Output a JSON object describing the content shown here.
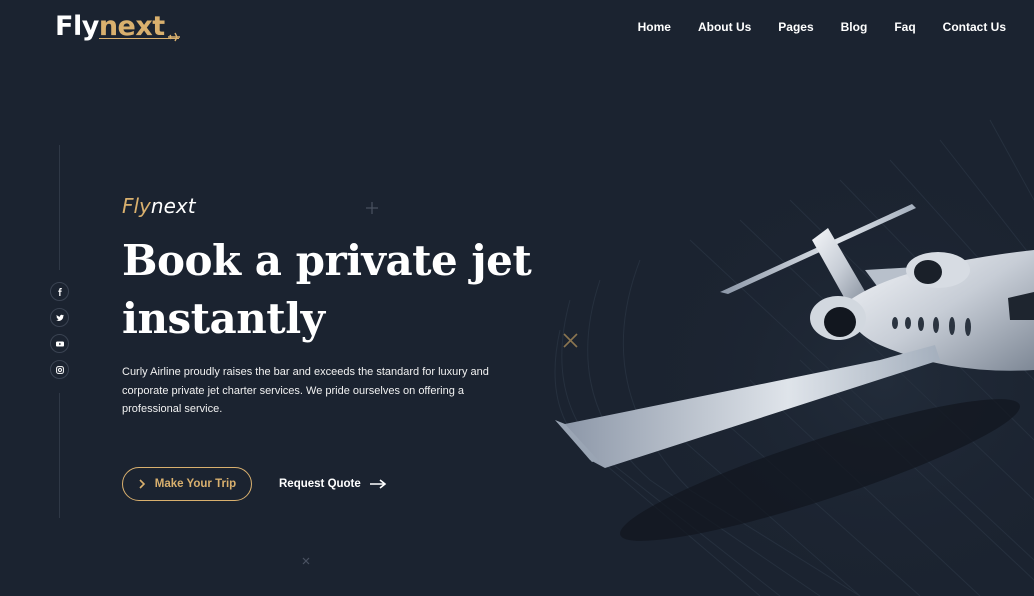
{
  "brand": {
    "logo_white": "Fly",
    "logo_gold": "next"
  },
  "nav": {
    "items": [
      {
        "label": "Home"
      },
      {
        "label": "About Us"
      },
      {
        "label": "Pages"
      },
      {
        "label": "Blog"
      },
      {
        "label": "Faq"
      },
      {
        "label": "Contact Us"
      }
    ]
  },
  "social": {
    "icons": [
      "facebook-icon",
      "twitter-icon",
      "youtube-icon",
      "instagram-icon"
    ]
  },
  "hero": {
    "eyebrow_gold": "Fly",
    "eyebrow_white": "next",
    "headline_line1": "Book a private jet",
    "headline_line2": "instantly",
    "description": "Curly Airline proudly raises the bar and exceeds the standard for luxury and corporate private jet charter services. We pride ourselves on offering a professional service.",
    "primary_button": "Make Your Trip",
    "secondary_button": "Request Quote"
  },
  "colors": {
    "background": "#1b2330",
    "accent": "#d9b06e",
    "text": "#ffffff"
  }
}
